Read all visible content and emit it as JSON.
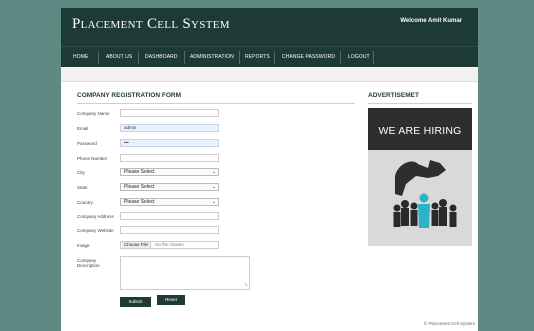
{
  "site": {
    "title": "Placement Cell System",
    "welcome": "Welcome Amit Kumar"
  },
  "nav": [
    "HOME",
    "ABOUT US",
    "DASHBOARD",
    "ADMINISTRATION",
    "REPORTS",
    "CHANGE PASSWORD",
    "LOGOUT"
  ],
  "form": {
    "title": "COMPANY REGISTRATION FORM",
    "labels": {
      "company_name": "Company Name",
      "email": "Email",
      "password": "Password",
      "phone": "Phone Number",
      "city": "City",
      "state": "State",
      "country": "Country",
      "address": "Company Address",
      "website": "Company Website",
      "image": "Image",
      "description": "Company Description"
    },
    "values": {
      "email": "admin",
      "password": "•••",
      "city": "Please Select",
      "state": "Please Select",
      "country": "Please Select"
    },
    "file": {
      "button": "Choose File",
      "status": "No file chosen"
    },
    "submit": "Submit",
    "reset": "Reset"
  },
  "advertisement": {
    "title": "ADVERTISEMET",
    "banner_text": "WE ARE HIRING"
  },
  "footer": "© Placement Cell System",
  "colors": {
    "header": "#1e3a37",
    "backdrop": "#5f8a83",
    "highlight": "#2bb3c8"
  }
}
